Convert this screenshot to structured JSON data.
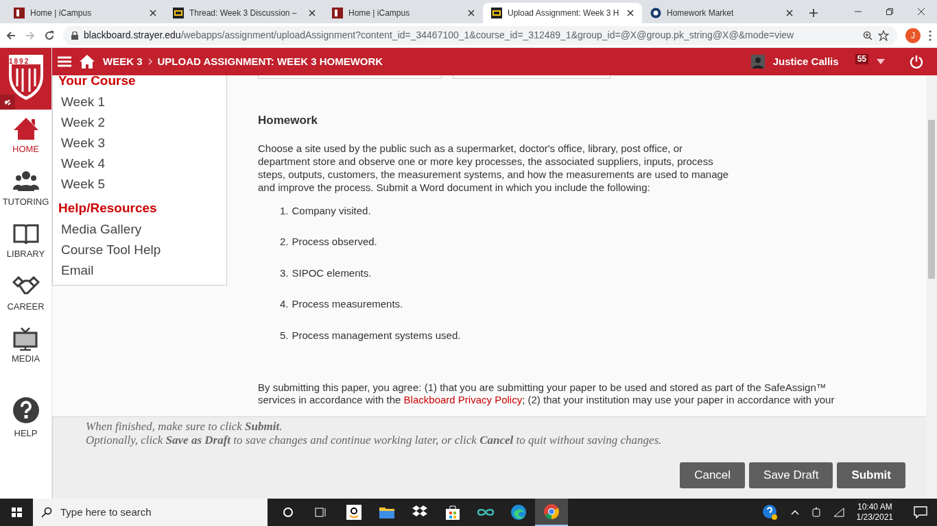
{
  "browser": {
    "tabs": [
      {
        "label": "Home | iCampus",
        "kind": "icampus",
        "selected": false
      },
      {
        "label": "Thread: Week 3 Discussion –",
        "kind": "bb",
        "selected": false
      },
      {
        "label": "Home | iCampus",
        "kind": "icampus",
        "selected": false
      },
      {
        "label": "Upload Assignment: Week 3 H",
        "kind": "bb",
        "selected": true
      },
      {
        "label": "Homework Market",
        "kind": "hm",
        "selected": false
      }
    ],
    "url_host": "blackboard.strayer.edu",
    "url_path": "/webapps/assignment/uploadAssignment?content_id=_34467100_1&course_id=_312489_1&group_id=@X@group.pk_string@X@&mode=view",
    "profile": "J"
  },
  "header": {
    "logo_year": "1892",
    "breadcrumb": [
      "WEEK 3",
      "UPLOAD ASSIGNMENT: WEEK 3 HOMEWORK"
    ],
    "user": "Justice Callis",
    "notifications": "55"
  },
  "rail": {
    "items": [
      {
        "label": "HOME",
        "kind": "home",
        "selected": true
      },
      {
        "label": "TUTORING",
        "kind": "tutoring",
        "selected": false
      },
      {
        "label": "LIBRARY",
        "kind": "library",
        "selected": false
      },
      {
        "label": "CAREER",
        "kind": "career",
        "selected": false
      },
      {
        "label": "MEDIA",
        "kind": "media",
        "selected": false
      }
    ],
    "help": "HELP"
  },
  "menu": {
    "sections": [
      {
        "title": "Your Course",
        "items": [
          "Week 1",
          "Week 2",
          "Week 3",
          "Week 4",
          "Week 5"
        ]
      },
      {
        "title": "Help/Resources",
        "items": [
          "Media Gallery",
          "Course Tool Help",
          "Email"
        ]
      }
    ]
  },
  "content": {
    "heading": "Homework",
    "intro": "Choose a site used by the public such as a supermarket, doctor's office, library, post office, or department store and observe one or more key processes, the associated suppliers, inputs, process steps, outputs, customers, the measurement systems, and how the measurements are used to manage and improve the process. Submit a Word document in which you include the following:",
    "list": [
      {
        "number": "1.",
        "text": "Company visited."
      },
      {
        "number": "2.",
        "text": "Process observed."
      },
      {
        "number": "3.",
        "text": "SIPOC elements."
      },
      {
        "number": "4.",
        "text": "Process measurements."
      },
      {
        "number": "5.",
        "text": "Process management systems used."
      }
    ],
    "agreement_line_1": "By submitting this paper, you agree: (1) that you are submitting your paper to be used and stored as part of the SafeAssign™",
    "agreement_line_2_before": "services in accordance with the ",
    "agreement_link": "Blackboard Privacy Policy",
    "agreement_line_2_after": "; (2) that your institution may use your paper in accordance with your"
  },
  "footer": {
    "instructions": [
      "When finished, make sure to click **Submit**.",
      "Optionally, click **Save as Draft** to save changes and continue working later, or click **Cancel** to quit without saving changes."
    ],
    "buttons": [
      "Cancel",
      "Save Draft",
      "Submit"
    ]
  },
  "taskbar": {
    "search_placeholder": "Type here to search",
    "time": "10:40 AM",
    "date": "1/23/2021"
  }
}
